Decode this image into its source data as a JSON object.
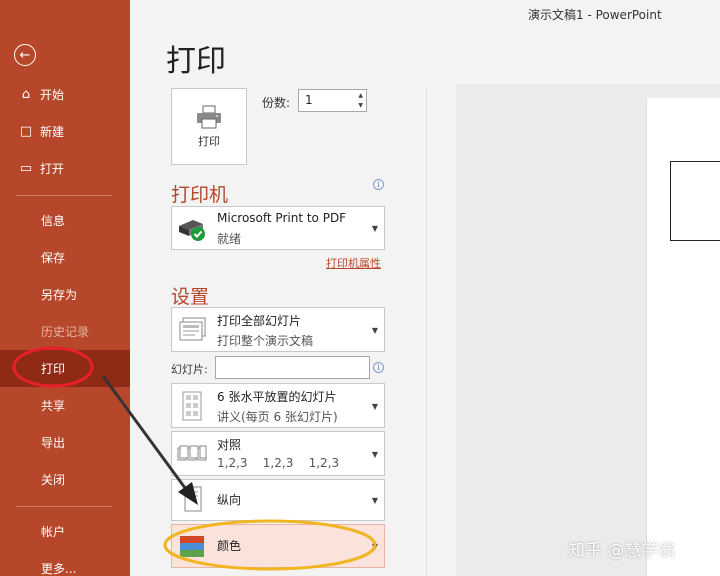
{
  "window": {
    "title": "演示文稿1  -  PowerPoint"
  },
  "sidebar": {
    "back_icon": "arrow-left-icon",
    "items": [
      {
        "label": "开始",
        "icon": "home-icon"
      },
      {
        "label": "新建",
        "icon": "new-document-icon"
      },
      {
        "label": "打开",
        "icon": "folder-open-icon"
      },
      {
        "label": "信息"
      },
      {
        "label": "保存"
      },
      {
        "label": "另存为"
      },
      {
        "label": "历史记录",
        "disabled": true
      },
      {
        "label": "打印",
        "active": true
      },
      {
        "label": "共享"
      },
      {
        "label": "导出"
      },
      {
        "label": "关闭"
      },
      {
        "label": "帐户"
      },
      {
        "label": "更多..."
      }
    ],
    "accent_color": "#b7472a",
    "active_color": "#8e2a16"
  },
  "main": {
    "title": "打印",
    "print_button_label": "打印",
    "copies": {
      "label": "份数:",
      "value": "1"
    },
    "printer": {
      "heading": "打印机",
      "name": "Microsoft Print to PDF",
      "status": "就绪",
      "properties_link": "打印机属性"
    },
    "settings": {
      "heading": "设置",
      "range": {
        "main": "打印全部幻灯片",
        "sub": "打印整个演示文稿"
      },
      "slides_label": "幻灯片:",
      "slides_value": "",
      "layout": {
        "main": "6 张水平放置的幻灯片",
        "sub": "讲义(每页 6 张幻灯片)"
      },
      "collation": {
        "main": "对照",
        "sub": "1,2,3    1,2,3    1,2,3"
      },
      "orientation": {
        "main": "纵向"
      },
      "color": {
        "main": "颜色"
      }
    }
  },
  "watermark": "知乎 @慧学翁"
}
